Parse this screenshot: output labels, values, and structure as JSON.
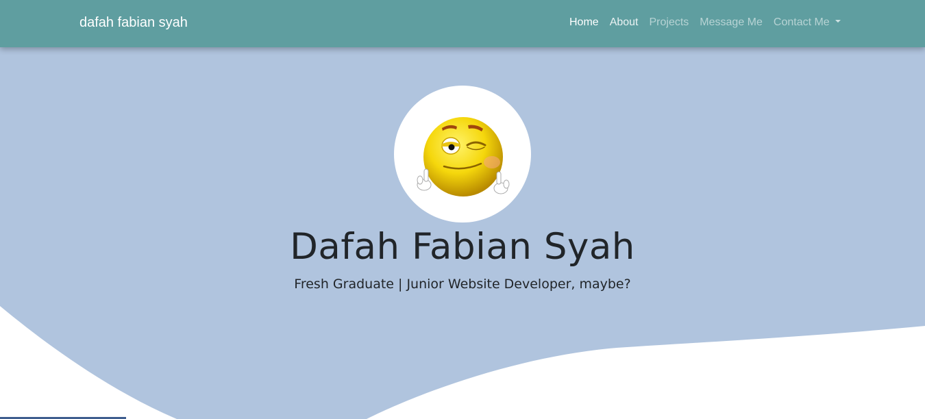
{
  "navbar": {
    "brand": "dafah fabian syah",
    "links": [
      {
        "label": "Home",
        "state": "active"
      },
      {
        "label": "About",
        "state": "normal"
      },
      {
        "label": "Projects",
        "state": "muted"
      },
      {
        "label": "Message Me",
        "state": "muted"
      },
      {
        "label": "Contact Me",
        "state": "muted",
        "dropdown": true
      }
    ]
  },
  "hero": {
    "avatar_icon": "winking-emoji-thumbs-up",
    "title": "Dafah Fabian Syah",
    "subtitle": "Fresh Graduate | Junior Website Developer, maybe?"
  },
  "colors": {
    "navbar_bg": "#5f9ea0",
    "hero_bg": "#b0c4de",
    "page_bg": "#ffffff",
    "text": "#212529"
  }
}
